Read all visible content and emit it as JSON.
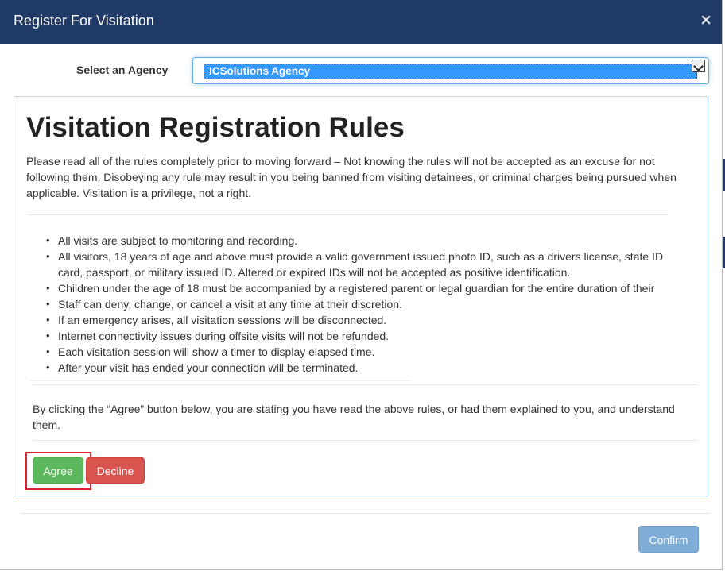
{
  "modal": {
    "title": "Register For Visitation",
    "close_glyph": "×",
    "close_icon": "close-icon"
  },
  "agency": {
    "label": "Select an Agency",
    "selected": "ICSolutions Agency",
    "dropdown_icon": "chevron-down-icon"
  },
  "rules": {
    "title": "Visitation Registration Rules",
    "intro": "Please read all of the rules completely prior to moving forward – Not knowing the rules will not be accepted as an excuse for not following them. Disobeying any rule may result in you being banned from visiting detainees, or criminal charges being pursued when applicable. Visitation is a privilege, not a right.",
    "items": [
      "All visits are subject to monitoring and recording.",
      "All visitors, 18 years of age and above must provide a valid government issued photo ID, such as a drivers license, state ID card, passport, or military issued ID. Altered or expired IDs will not be accepted as positive identification.",
      "Children under the age of 18 must be accompanied by a registered parent or legal guardian for the entire duration of their",
      "Staff can deny, change, or cancel a visit at any time at their discretion.",
      "If an emergency arises, all visitation sessions will be disconnected.",
      "Internet connectivity issues during offsite visits will not be refunded.",
      "Each visitation session will show a timer to display elapsed time.",
      "After your visit has ended your connection will be terminated."
    ],
    "agreement": "By clicking the “Agree” button below, you are stating you have read the above rules, or had them explained to you, and understand them."
  },
  "buttons": {
    "agree": "Agree",
    "decline": "Decline",
    "confirm": "Confirm"
  },
  "colors": {
    "header": "#1f3a66",
    "agree": "#5cb85c",
    "decline": "#d9534f",
    "confirm": "#7fadd8",
    "highlight": "#d9232e",
    "selection": "#3399ff"
  }
}
